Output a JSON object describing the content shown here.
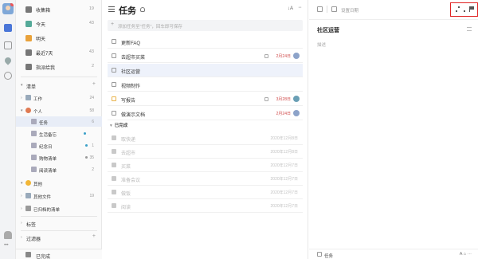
{
  "sidebar": {
    "smart_lists": [
      {
        "label": "收集箱",
        "count": "19"
      },
      {
        "label": "今天",
        "count": "43"
      },
      {
        "label": "明天",
        "count": ""
      },
      {
        "label": "最近7天",
        "count": "43"
      },
      {
        "label": "指派给我",
        "count": "2"
      }
    ],
    "lists_header": "清单",
    "lists": [
      {
        "label": "工作",
        "count": "24"
      },
      {
        "label": "个人",
        "count": "58"
      },
      {
        "label": "任务",
        "count": "6"
      },
      {
        "label": "生活备忘",
        "count": ""
      },
      {
        "label": "纪念日",
        "count": "1"
      },
      {
        "label": "购物清单",
        "count": "35"
      },
      {
        "label": "阅读清单",
        "count": "2"
      },
      {
        "label": "其他",
        "count": ""
      },
      {
        "label": "其他文件",
        "count": "19"
      },
      {
        "label": "已归档的清单",
        "count": ""
      }
    ],
    "tags_header": "标签",
    "filters_header": "过滤器",
    "completed_label": "已完成"
  },
  "main": {
    "title": "任务",
    "sort_label": "↓A",
    "more_label": "···",
    "add_placeholder": "添加任务至\"任务\"，回车即可保存",
    "tasks": [
      {
        "title": "更新FAQ",
        "date": "",
        "selected": false
      },
      {
        "title": "去超市买菜",
        "date": "2月24日",
        "selected": false
      },
      {
        "title": "社区运营",
        "date": "",
        "selected": true
      },
      {
        "title": "视频制作",
        "date": "",
        "selected": false
      },
      {
        "title": "写报告",
        "date": "3月28日",
        "selected": false
      },
      {
        "title": "做演示文档",
        "date": "2月24日",
        "selected": false
      }
    ],
    "completed_header": "已完成",
    "completed_tasks": [
      {
        "title": "取快递",
        "date": "2020年12月8日"
      },
      {
        "title": "去超市",
        "date": "2020年12月8日"
      },
      {
        "title": "买菜",
        "date": "2020年12月7日"
      },
      {
        "title": "准备会议",
        "date": "2020年12月7日"
      },
      {
        "title": "做饭",
        "date": "2020年12月7日"
      },
      {
        "title": "阅读",
        "date": "2020年12月7日"
      }
    ]
  },
  "detail": {
    "date_placeholder": "设置日期",
    "title": "社区运营",
    "description_placeholder": "描述",
    "footer_list": "任务",
    "footer_right": "A  ⌂  ···"
  },
  "colors": {
    "accent": "#4a76d8",
    "overdue": "#d04a4a",
    "highlight_box": "#e02424"
  }
}
